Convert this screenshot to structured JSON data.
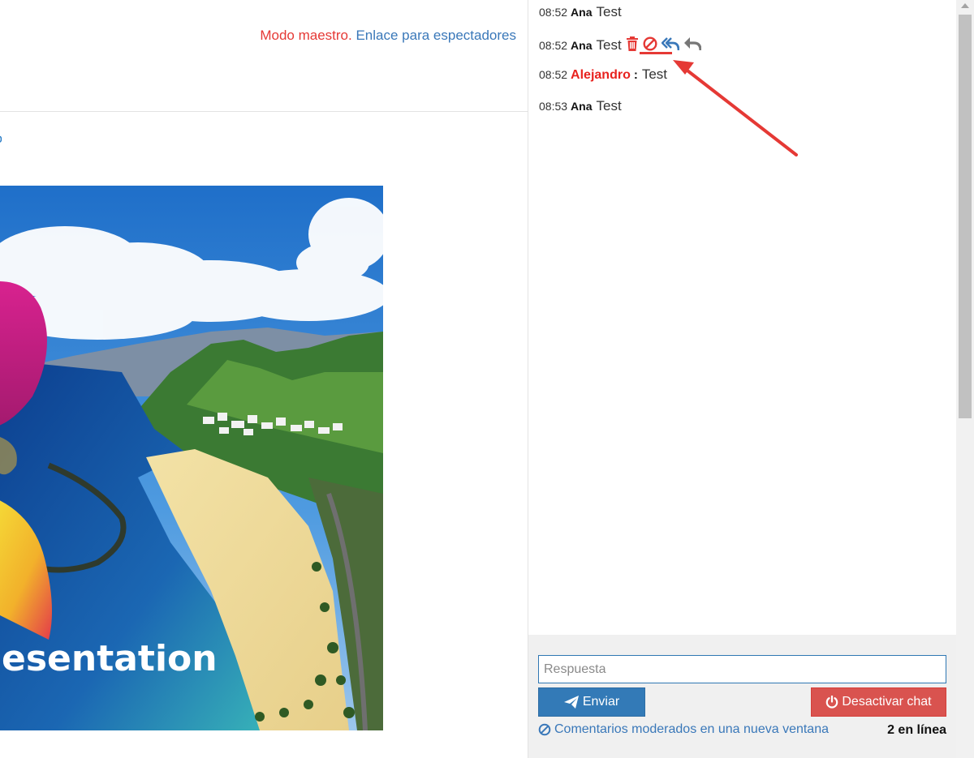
{
  "header": {
    "mode_label": "Modo maestro.",
    "viewer_link": "Enlace para espectadores"
  },
  "slide": {
    "caption": "esentation"
  },
  "chat": {
    "messages": [
      {
        "time": "08:52",
        "author": "Ana",
        "text": "Test"
      },
      {
        "time": "08:52",
        "author": "Ana",
        "text": "Test",
        "actions": [
          "trash-icon",
          "ban-icon",
          "reply-all-icon",
          "reply-icon"
        ]
      },
      {
        "time": "08:52",
        "author": "Alejandro",
        "separator": ":",
        "text": "Test"
      },
      {
        "time": "08:53",
        "author": "Ana",
        "text": "Test"
      }
    ],
    "reply_placeholder": "Respuesta",
    "send_label": "Enviar",
    "disable_label": "Desactivar chat",
    "moderated_label": "Comentarios moderados en una nueva ventana",
    "online_label": "2 en línea"
  },
  "colors": {
    "teacher_red": "#e8231f",
    "link_blue": "#3a78b9",
    "primary_button": "#337ab7",
    "danger_button": "#d9534f",
    "annotation_arrow": "#e53935"
  }
}
